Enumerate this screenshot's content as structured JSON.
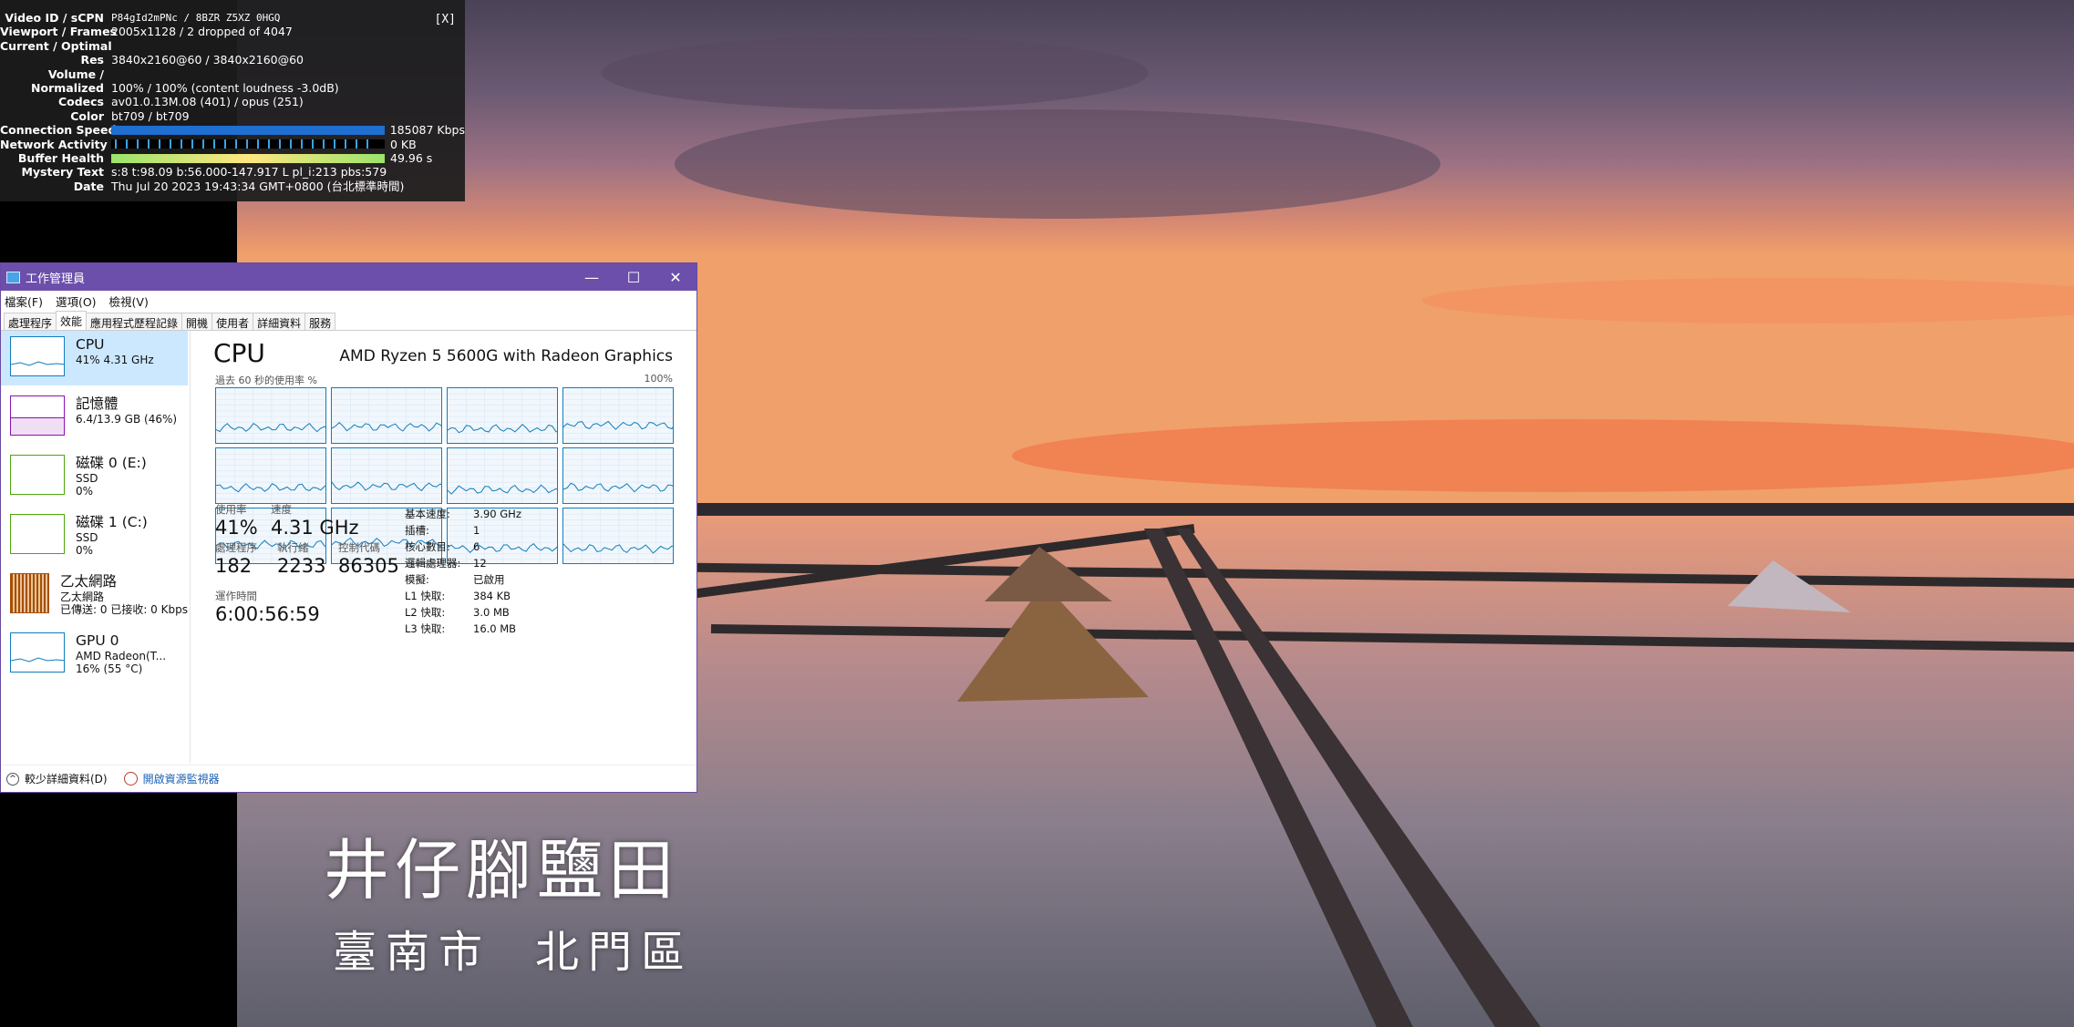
{
  "video": {
    "caption_line1": "井仔腳鹽田",
    "caption_line2_a": "臺南市",
    "caption_line2_b": "北門區"
  },
  "stats": {
    "close_label": "[X]",
    "rows": [
      {
        "label": "Video ID / sCPN",
        "value": "P84gId2mPNc / 8BZR Z5XZ 0HGQ"
      },
      {
        "label": "Viewport / Frames",
        "value": "2005x1128 / 2 dropped of 4047"
      },
      {
        "label": "Current / Optimal",
        "value": ""
      },
      {
        "label": "Res",
        "value": "3840x2160@60 / 3840x2160@60"
      },
      {
        "label": "Volume /",
        "value": ""
      },
      {
        "label": "Normalized",
        "value": "100% / 100% (content loudness -3.0dB)"
      },
      {
        "label": "Codecs",
        "value": "av01.0.13M.08 (401) / opus (251)"
      },
      {
        "label": "Color",
        "value": "bt709 / bt709"
      },
      {
        "label": "Connection Speed",
        "value": "185087 Kbps"
      },
      {
        "label": "Network Activity",
        "value": "0 KB"
      },
      {
        "label": "Buffer Health",
        "value": "49.96 s"
      },
      {
        "label": "Mystery Text",
        "value": "s:8 t:98.09 b:56.000-147.917 L pl_i:213 pbs:579"
      },
      {
        "label": "Date",
        "value": "Thu Jul 20 2023 19:43:34 GMT+0800 (台北標準時間)"
      }
    ],
    "colors": {
      "connection": "#1e6fd0",
      "network": "#3ba3e8",
      "buffer": "#9be36b"
    }
  },
  "taskmanager": {
    "title": "工作管理員",
    "window_buttons": {
      "minimize": "—",
      "maximize": "☐",
      "close": "✕"
    },
    "menu": [
      "檔案(F)",
      "選項(O)",
      "檢視(V)"
    ],
    "tabs": [
      "處理程序",
      "效能",
      "應用程式歷程記錄",
      "開機",
      "使用者",
      "詳細資料",
      "服務"
    ],
    "active_tab": "效能",
    "sidebar": [
      {
        "name": "CPU",
        "line1": "41% 4.31 GHz",
        "line2": "",
        "color": "#117dbb"
      },
      {
        "name": "記憶體",
        "line1": "6.4/13.9 GB (46%)",
        "line2": "",
        "color": "#8b12ae"
      },
      {
        "name": "磁碟 0 (E:)",
        "line1": "SSD",
        "line2": "0%",
        "color": "#4da60c"
      },
      {
        "name": "磁碟 1 (C:)",
        "line1": "SSD",
        "line2": "0%",
        "color": "#4da60c"
      },
      {
        "name": "乙太網路",
        "line1": "乙太網路",
        "line2": "已傳送: 0 已接收: 0 Kbps",
        "color": "#a74f01"
      },
      {
        "name": "GPU 0",
        "line1": "AMD Radeon(T...",
        "line2": "16% (55 °C)",
        "color": "#117dbb"
      }
    ],
    "detail": {
      "title": "CPU",
      "model": "AMD Ryzen 5 5600G with Radeon Graphics",
      "graph_caption": "過去 60 秒的使用率 %",
      "graph_max": "100%",
      "utilization_label": "使用率",
      "utilization": "41%",
      "speed_label": "速度",
      "speed": "4.31 GHz",
      "processes_label": "處理程序",
      "processes": "182",
      "threads_label": "執行緒",
      "threads": "2233",
      "handles_label": "控制代碼",
      "handles": "86305",
      "uptime_label": "運作時間",
      "uptime": "6:00:56:59",
      "specs": [
        {
          "k": "基本速度:",
          "v": "3.90 GHz"
        },
        {
          "k": "插槽:",
          "v": "1"
        },
        {
          "k": "核心數目:",
          "v": "6"
        },
        {
          "k": "邏輯處理器:",
          "v": "12"
        },
        {
          "k": "模擬:",
          "v": "已啟用"
        },
        {
          "k": "L1 快取:",
          "v": "384 KB"
        },
        {
          "k": "L2 快取:",
          "v": "3.0 MB"
        },
        {
          "k": "L3 快取:",
          "v": "16.0 MB"
        }
      ],
      "core_levels": [
        0.3,
        0.32,
        0.28,
        0.35,
        0.3,
        0.33,
        0.27,
        0.31,
        0.36,
        0.4,
        0.3,
        0.29
      ]
    },
    "footer": {
      "less_details": "較少詳細資料(D)",
      "resource_monitor": "開啟資源監視器"
    }
  }
}
